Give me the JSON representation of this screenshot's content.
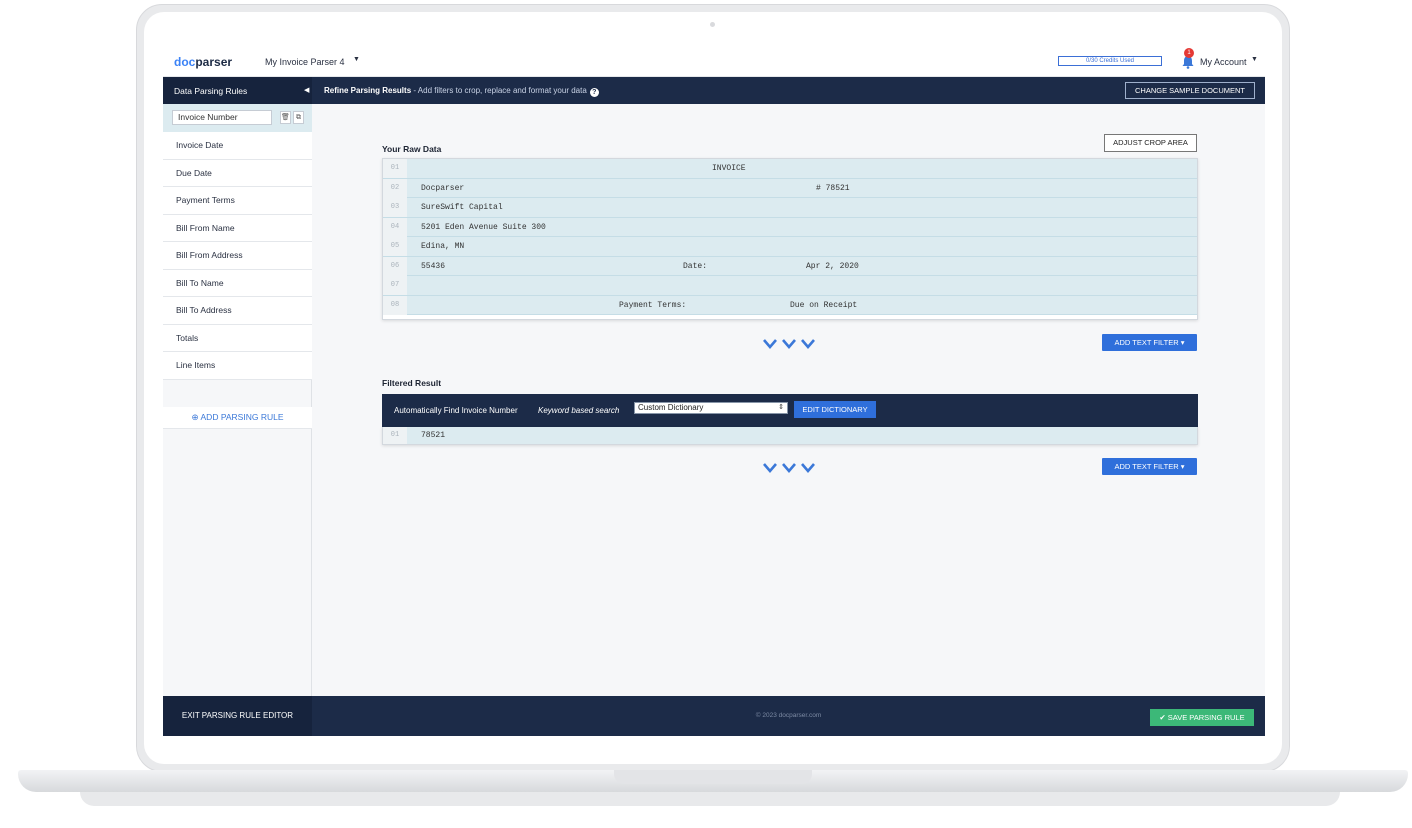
{
  "brand": {
    "logo_prefix": "doc",
    "logo_suffix": "parser"
  },
  "header": {
    "parser_name": "My Invoice Parser 4",
    "credits_label": "0/30 Credits Used",
    "notifications_count": "1",
    "account_label": "My Account"
  },
  "subbar": {
    "sidebar_title": "Data Parsing Rules",
    "refine_title": "Refine Parsing Results",
    "refine_subtitle": " - Add filters to crop, replace and format your data",
    "change_sample_label": "CHANGE SAMPLE DOCUMENT"
  },
  "sidebar": {
    "active_rule": "Invoice Number",
    "items": [
      {
        "label": "Invoice Date"
      },
      {
        "label": "Due Date"
      },
      {
        "label": "Payment Terms"
      },
      {
        "label": "Bill From Name"
      },
      {
        "label": "Bill From Address"
      },
      {
        "label": "Bill To Name"
      },
      {
        "label": "Bill To Address"
      },
      {
        "label": "Totals"
      },
      {
        "label": "Line Items"
      }
    ],
    "add_rule_label": "ADD PARSING RULE",
    "exit_label": "EXIT PARSING RULE EDITOR"
  },
  "raw": {
    "title": "Your Raw Data",
    "adjust_label": "ADJUST CROP AREA",
    "rows": [
      {
        "n": "01",
        "a": "",
        "b": "INVOICE",
        "c": ""
      },
      {
        "n": "02",
        "a": "Docparser",
        "b": "",
        "c": "# 78521"
      },
      {
        "n": "03",
        "a": "SureSwift Capital",
        "b": "",
        "c": ""
      },
      {
        "n": "04",
        "a": "5201 Eden Avenue Suite 300",
        "b": "",
        "c": ""
      },
      {
        "n": "05",
        "a": "Edina, MN",
        "b": "",
        "c": ""
      },
      {
        "n": "06",
        "a": "55436",
        "b": "Date:",
        "c": "Apr 2, 2020"
      },
      {
        "n": "07",
        "a": "",
        "b": "",
        "c": ""
      },
      {
        "n": "08",
        "a": "",
        "b": "Payment Terms:",
        "c": "Due on Receipt"
      }
    ]
  },
  "filters": {
    "add_text_filter_label": "ADD TEXT FILTER"
  },
  "filtered": {
    "title": "Filtered Result",
    "auto_find_label": "Automatically Find Invoice Number",
    "keyword_label": "Keyword based search",
    "dictionary_value": "Custom Dictionary",
    "edit_dictionary_label": "EDIT DICTIONARY",
    "row_num": "01",
    "row_value": "78521"
  },
  "footer": {
    "copyright": "© 2023 docparser.com",
    "save_label": "SAVE PARSING RULE"
  },
  "colors": {
    "navy": "#1c2b48",
    "accent_blue": "#2f6fdb",
    "save_green": "#3cb878",
    "row_highlight": "#dcebf0"
  }
}
